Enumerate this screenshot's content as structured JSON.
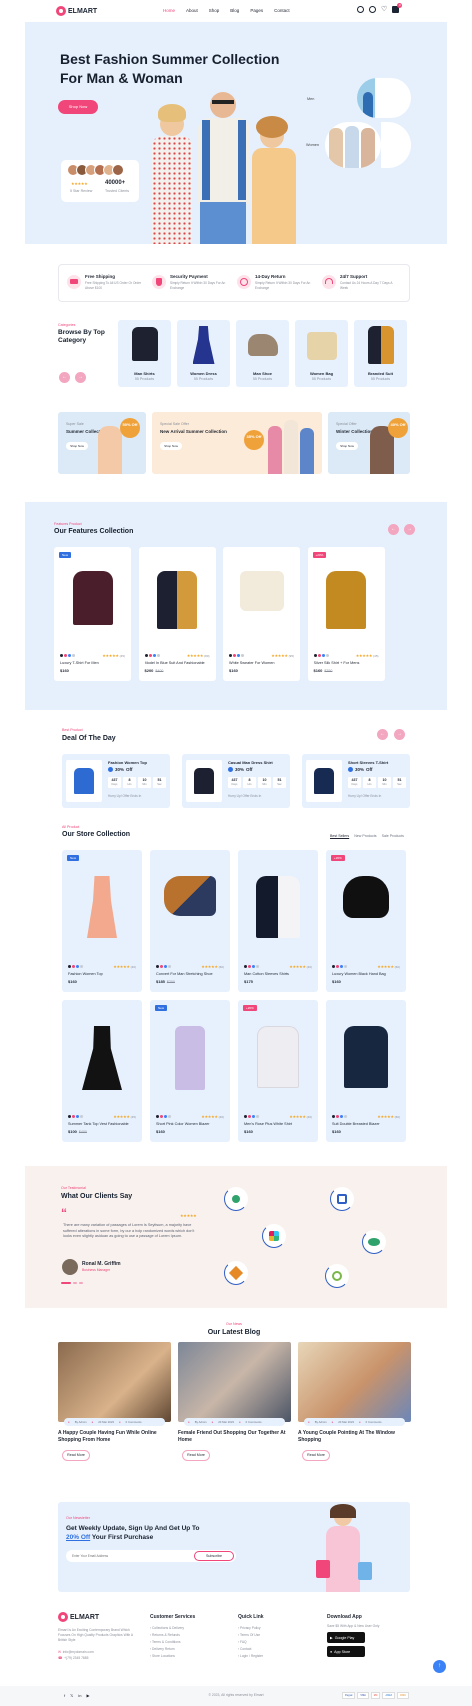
{
  "header": {
    "logo": "ELMART",
    "nav": [
      "Home",
      "About",
      "Shop",
      "Blog",
      "Pages",
      "Contact"
    ],
    "cart_count": "0"
  },
  "hero": {
    "title_line1": "Best Fashion Summer Collection",
    "title_line2": "For Man & Woman",
    "cta": "Shop Now",
    "rating_label": "5 Star Review",
    "clients_count": "40000+",
    "clients_label": "Trusted Clients",
    "men_label": "Men",
    "women_label": "Women"
  },
  "features": [
    {
      "title": "Free Shipping",
      "text": "Free Shipping To All US Order Or Order Above $100",
      "icon": "truck-icon"
    },
    {
      "title": "Security Payment",
      "text": "Simply Return It Within 30 Days For An Exchange",
      "icon": "shield-icon"
    },
    {
      "title": "14-Day Return",
      "text": "Simply Return It Within 30 Days For An Exchange",
      "icon": "return-icon"
    },
    {
      "title": "24/7 Support",
      "text": "Contact Us 24 Hours A Day 7 Days A Week",
      "icon": "support-icon"
    }
  ],
  "categories": {
    "eyebrow": "Categories",
    "title": "Browse By Top Category",
    "items": [
      {
        "name": "Man Shirts",
        "count": "55 Products"
      },
      {
        "name": "Women Dress",
        "count": "55 Products"
      },
      {
        "name": "Man Shoe",
        "count": "55 Products"
      },
      {
        "name": "Women Bag",
        "count": "55 Products"
      },
      {
        "name": "Branded Suit",
        "count": "55 Products"
      }
    ]
  },
  "banners": [
    {
      "eyebrow": "Super Sale",
      "title": "Summer Collection",
      "badge": "50% Off",
      "cta": "Shop Now"
    },
    {
      "eyebrow": "Special Sale Offer",
      "title": "New Arrival Summer Collection",
      "badge": "35% Off",
      "cta": "Shop Now"
    },
    {
      "eyebrow": "Special Offer",
      "title": "Winter Collection",
      "badge": "40% Off",
      "cta": "Shop Now"
    }
  ],
  "featured": {
    "eyebrow": "Features Product",
    "title": "Our Features Collection",
    "items": [
      {
        "name": "Luxury T-Shirt For Men",
        "price": "$160",
        "old": "",
        "badge": "New",
        "reviews": "(45)"
      },
      {
        "name": "Model In Blue Suit And Fashionable",
        "price": "$200",
        "old": "$400",
        "badge": "",
        "reviews": "(80)"
      },
      {
        "name": "White Sweater For Women",
        "price": "$160",
        "old": "",
        "badge": "",
        "reviews": "(95)"
      },
      {
        "name": "Silver Silk Shirt + For Mens",
        "price": "$160",
        "old": "$350",
        "badge": "+20%",
        "reviews": "(45)"
      }
    ]
  },
  "deal": {
    "eyebrow": "Best Product",
    "title": "Deal Of The Day",
    "items": [
      {
        "name": "Fashion Women Top",
        "off_num": "30%",
        "off": "Off",
        "ends": "Hurry Up! Offer Ends In",
        "timer": [
          "437",
          "8",
          "10",
          "51"
        ]
      },
      {
        "name": "Casual Man Dress Shirt",
        "off_num": "30%",
        "off": "Off",
        "ends": "Hurry Up! Offer Ends In",
        "timer": [
          "437",
          "8",
          "10",
          "51"
        ]
      },
      {
        "name": "Short Sleeves T-Shirt",
        "off_num": "30%",
        "off": "Off",
        "ends": "Hurry Up! Offer Ends In",
        "timer": [
          "437",
          "8",
          "10",
          "51"
        ]
      }
    ],
    "timer_labels": [
      "Days",
      "Hrs",
      "Min",
      "Sec"
    ]
  },
  "store": {
    "eyebrow": "All Product",
    "title": "Our Store Collection",
    "tabs": [
      "Best Sellers",
      "New Products",
      "Sale Products"
    ],
    "items": [
      {
        "name": "Fashion Women Top",
        "price": "$160",
        "old": "",
        "badge": "New",
        "reviews": "(40)"
      },
      {
        "name": "Convert For Man Stretching Shoe",
        "price": "$185",
        "old": "$200",
        "badge": "",
        "reviews": "(60)"
      },
      {
        "name": "Man Cotton Sleeves Shirts",
        "price": "$175",
        "old": "",
        "badge": "",
        "reviews": "(40)"
      },
      {
        "name": "Luxury Women Black Hand Bag",
        "price": "$160",
        "old": "",
        "badge": "+20%",
        "reviews": "(60)"
      },
      {
        "name": "Summer Tank Top Vest Fashionable",
        "price": "$100",
        "old": "$400",
        "badge": "",
        "reviews": "(45)"
      },
      {
        "name": "Short Pink Color Women Blazer",
        "price": "$160",
        "old": "",
        "badge": "New",
        "reviews": "(40)"
      },
      {
        "name": "Men's Rose Plus White Shirt",
        "price": "$160",
        "old": "",
        "badge": "+20%",
        "reviews": "(40)"
      },
      {
        "name": "Suit Double Breasted Blazer",
        "price": "$160",
        "old": "",
        "badge": "",
        "reviews": "(60)"
      }
    ]
  },
  "testimonial": {
    "eyebrow": "Our Testimonial",
    "title": "What Our Clients Say",
    "quote": "There are many variation of passages of Lorem Is Seyitsum, a majority have suffered alterations in some form, by our a holp randomized words which don't looks even slightly asiduan as going to use a passage of Lorem Ipsum.",
    "name": "Ronal M. Griffim",
    "role": "Business Manager"
  },
  "blog": {
    "eyebrow": "Our News",
    "title": "Our Latest Blog",
    "posts": [
      {
        "title": "A Happy Couple Having Fun While Online Shopping From Home",
        "by": "By Admin",
        "date": "20 Mar 2023",
        "comments": "0 Comments",
        "cta": "Read More"
      },
      {
        "title": "Female Friend Out Shopping Our Together At Home",
        "by": "By Admin",
        "date": "20 Mar 2023",
        "comments": "0 Comments",
        "cta": "Read More"
      },
      {
        "title": "A Young Couple Pointing At The Window Shopping",
        "by": "By Admin",
        "date": "20 Mar 2023",
        "comments": "0 Comments",
        "cta": "Read More"
      }
    ]
  },
  "newsletter": {
    "eyebrow": "Our Newsletter",
    "title_line1": "Get Weekly Update, Sign Up And Get Up To",
    "highlight": "20% Off",
    "title_line2": "Your First Purchase",
    "placeholder": "Enter Your Email Address",
    "cta": "Subscribe"
  },
  "footer": {
    "logo": "ELMART",
    "about": "Elmart Is An Exciting Contemporary Brand Which Focuses On High Quality Products Graphics With A British Style",
    "email": "info@mydomain.com",
    "phone": "+(79) 2345 7885",
    "col1_title": "Customer Services",
    "col1": [
      "Collections & Delivery",
      "Returns & Refunds",
      "Terms & Conditions",
      "Delivery Return",
      "Store Locations"
    ],
    "col2_title": "Quick Link",
    "col2": [
      "Privacy Policy",
      "Terms Of Use",
      "FAQ",
      "Contact",
      "Login / Register"
    ],
    "col3_title": "Download App",
    "col3_text": "Save $5 With App & New User Only",
    "google_play": "Google Play",
    "app_store": "App Store",
    "copyright": "© 2023, All rights reserved by Elmart",
    "payments": [
      "Paypal",
      "VISA",
      "MC",
      "AMEX",
      "DISC"
    ]
  }
}
